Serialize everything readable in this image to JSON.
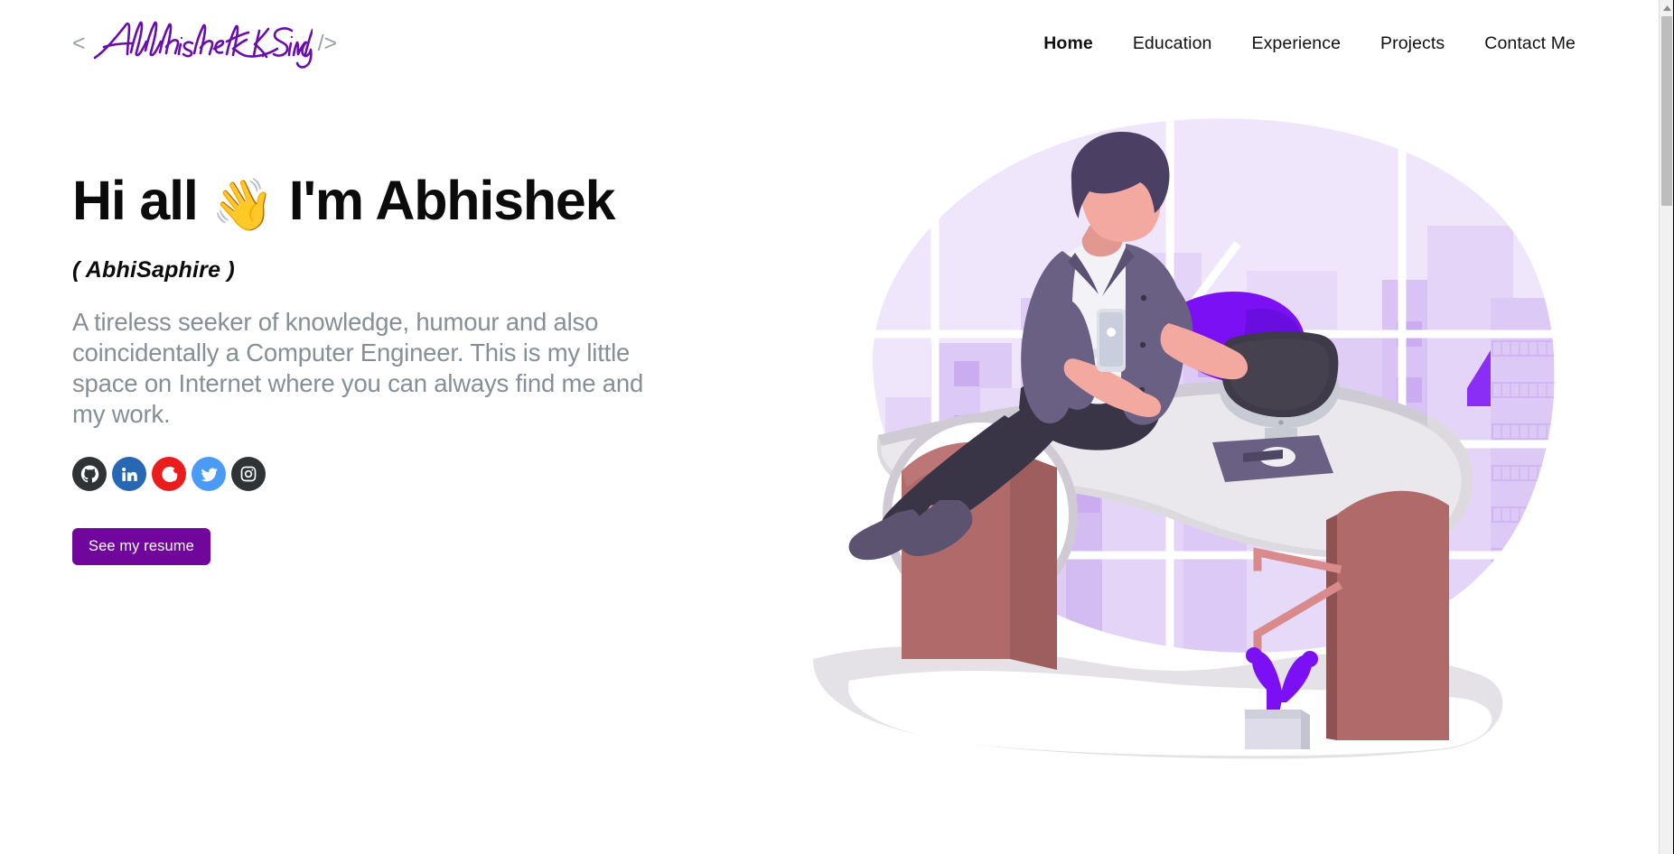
{
  "header": {
    "logo": {
      "open_bracket": "<",
      "signature_text": "Abhishek K. Singh",
      "close_bracket": "/>",
      "signature_color": "#6A0DAD",
      "bracket_color": "#9aa0a6"
    },
    "nav": {
      "items": [
        {
          "label": "Home",
          "active": true
        },
        {
          "label": "Education",
          "active": false
        },
        {
          "label": "Experience",
          "active": false
        },
        {
          "label": "Projects",
          "active": false
        },
        {
          "label": "Contact Me",
          "active": false
        }
      ]
    }
  },
  "hero": {
    "greeting_prefix": "Hi all ",
    "wave_emoji": "👋",
    "greeting_suffix": " I'm Abhishek",
    "alias": "( AbhiSaphire )",
    "bio": "A tireless seeker of knowledge, humour and also coincidentally a Computer Engineer. This is my little space on Internet where you can always find me and my work.",
    "resume_button": "See my resume",
    "bio_color": "#868e96",
    "button_color": "#70069c",
    "socials": [
      {
        "name": "github",
        "color": "#2f3336"
      },
      {
        "name": "linkedin",
        "color": "#2867B2"
      },
      {
        "name": "google",
        "color": "#EA1C1C"
      },
      {
        "name": "twitter",
        "color": "#4A9BF5"
      },
      {
        "name": "instagram",
        "color": "#2f3336"
      }
    ]
  },
  "illustration": {
    "name": "developer-sitting-on-desk-illustration",
    "palette": {
      "blob": "#EFE6FB",
      "building_light": "#E7DAF8",
      "building_mid": "#DCC9F5",
      "building_dark": "#C9ABF0",
      "skin": "#F4A9A0",
      "hair": "#4B3F63",
      "jacket": "#6A6083",
      "shirt": "#F3F3F7",
      "pants": "#3A3447",
      "desk": "#D8D5DC",
      "desk_panel": "#B06A6A",
      "chair": "#7B10F5",
      "monitor": "#3E3A4A",
      "cactus": "#7B10F5",
      "pot": "#D8D8E4"
    }
  },
  "scrollbar": {
    "up_arrow": "▲",
    "thumb_label": "vertical-scroll-thumb"
  }
}
